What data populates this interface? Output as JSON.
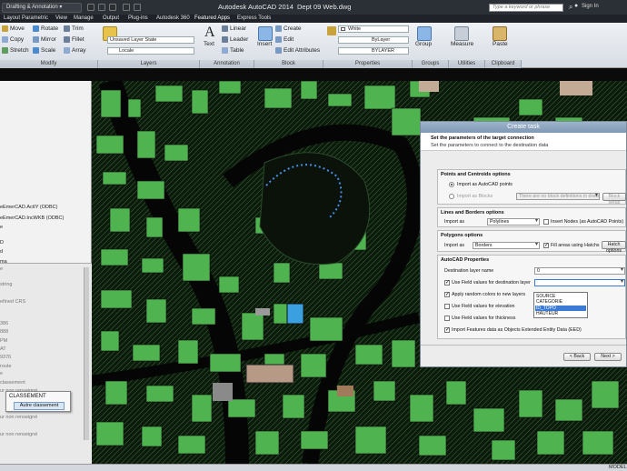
{
  "titlebar": {
    "workspace": "Drafting & Annotation",
    "app_title": "Autodesk AutoCAD 2014",
    "doc_title": "Dept 09 Web.dwg",
    "search_placeholder": "Type a keyword or phrase",
    "signin": "Sign In"
  },
  "menubar": [
    "Layout",
    "Parametric",
    "View",
    "Manage",
    "Output",
    "Plug-ins",
    "Autodesk 360",
    "Featured Apps",
    "Express Tools"
  ],
  "ribbon": {
    "modify": {
      "label": "Modify",
      "items": [
        "Move",
        "Rotate",
        "Trim",
        "Copy",
        "Mirror",
        "Fillet",
        "Stretch",
        "Scale",
        "Array"
      ]
    },
    "layers": {
      "label": "Layers",
      "layer_state": "Unsaved Layer State",
      "layer_combo": "Locale"
    },
    "annotation": {
      "label": "Annotation",
      "text": "Text",
      "items": [
        "Linear",
        "Leader",
        "Table"
      ]
    },
    "block": {
      "label": "Block",
      "insert": "Insert",
      "items": [
        "Create",
        "Edit",
        "Edit Attributes"
      ]
    },
    "properties": {
      "label": "Properties",
      "color": "White",
      "linetype": "ByLayer",
      "lineweight": "BYLAYER"
    },
    "groups": {
      "label": "Groups",
      "group": "Group"
    },
    "utilities": {
      "label": "Utilities",
      "measure": "Measure"
    },
    "clipboard": {
      "label": "Clipboard",
      "paste": "Paste"
    }
  },
  "palette": {
    "upper": [
      "eEmerCAD.ActIY (ODBC)",
      "eEmerCAD.IncWKB (ODBC)",
      "e",
      "D",
      "d",
      "ma"
    ],
    "lower": [
      "e",
      "string",
      "efined CRS",
      "",
      "386",
      "888",
      "PM",
      "AT",
      "9376",
      "",
      "route",
      "e",
      "classement",
      "ur non renseigné"
    ],
    "bottom": [
      "ur non renseigné",
      "ur non renseigné"
    ],
    "popup": {
      "title": "CLASSEMENT",
      "button": "Autre classement"
    }
  },
  "statusbar": {
    "model": "MODEL"
  },
  "dialog": {
    "title": "Create task",
    "header_title": "Set the parameters of the target connection",
    "header_subtitle": "Set the parameters to connect to the destination data",
    "points": {
      "title": "Points and Centroids options",
      "import_points": "Import as AutoCAD points",
      "import_blocks": "Import as Blocks",
      "block_combo": "There are no block definitions in drawing",
      "block_setup": "Block setup"
    },
    "lines": {
      "title": "Lines and Borders options",
      "import_as": "Import as",
      "combo": "Polylines",
      "insert_nodes": "Insert Nodes (as AutoCAD Points)"
    },
    "polygons": {
      "title": "Polygons options",
      "import_as": "Import as",
      "combo": "Borders",
      "fill": "Fill areas using Hatchs",
      "hatch_options": "Hatch options"
    },
    "props": {
      "title": "AutoCAD Properties",
      "dest_layer": "Destination layer name",
      "dest_layer_value": "0",
      "use_field_layer": "Use Field values for destination layer",
      "random_colors": "Apply random colors to new layers",
      "use_field_elev": "Use Field values for elevation",
      "use_field_thick": "Use Field values for thickness",
      "import_eed": "Import Features data as Objects Extended Entity Data (EED)"
    },
    "field_options": [
      "SOURCE",
      "CATEGORIE",
      "ID_TOPO",
      "HAUTEUR"
    ],
    "back": "< Back",
    "next": "Next >"
  }
}
